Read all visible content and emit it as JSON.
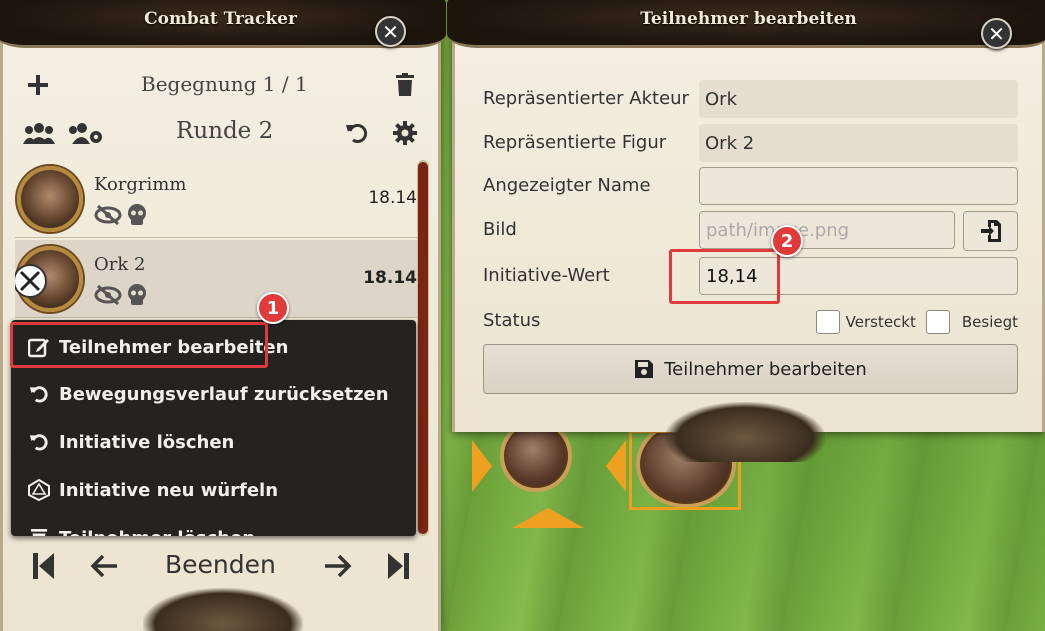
{
  "tracker": {
    "title": "Combat Tracker",
    "encounter": "Begegnung 1 / 1",
    "round": "Runde 2",
    "combatants": [
      {
        "name": "Korgrimm",
        "initiative": "18.14",
        "active": false
      },
      {
        "name": "Ork 2",
        "initiative": "18.14",
        "active": true
      }
    ],
    "context_menu": [
      {
        "label": "Teilnehmer bearbeiten",
        "icon": "edit-icon"
      },
      {
        "label": "Bewegungsverlauf zurücksetzen",
        "icon": "undo-icon"
      },
      {
        "label": "Initiative löschen",
        "icon": "undo-icon"
      },
      {
        "label": "Initiative neu würfeln",
        "icon": "dice-icon"
      },
      {
        "label": "Teilnehmer löschen",
        "icon": "trash-icon"
      }
    ],
    "end_label": "Beenden"
  },
  "edit_dialog": {
    "title": "Teilnehmer bearbeiten",
    "actor_label": "Repräsentierter Akteur",
    "actor_value": "Ork",
    "token_label": "Repräsentierte Figur",
    "token_value": "Ork 2",
    "name_label": "Angezeigter Name",
    "name_value": "",
    "image_label": "Bild",
    "image_placeholder": "path/image.png",
    "initiative_label": "Initiative-Wert",
    "initiative_value": "18,14",
    "status_label": "Status",
    "hidden_label": "Versteckt",
    "defeated_label": "Besiegt",
    "submit_label": "Teilnehmer bearbeiten"
  },
  "annotations": {
    "badge1": "1",
    "badge2": "2",
    "color": "#e03a3a"
  }
}
